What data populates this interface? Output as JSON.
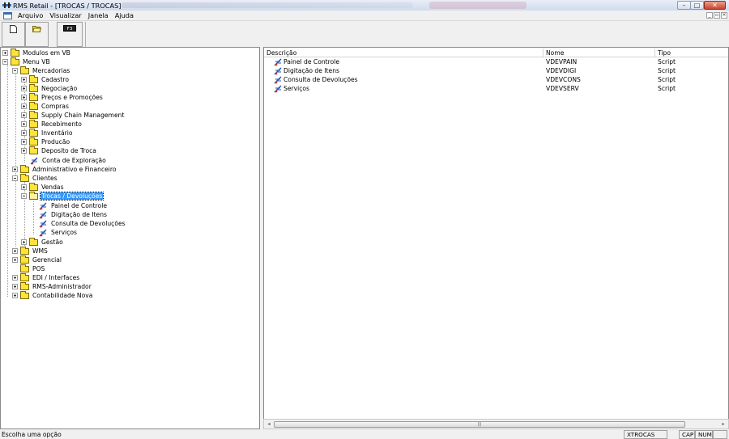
{
  "window": {
    "title": "RMS Retail - [TROCAS / TROCAS]",
    "min_glyph": "–",
    "max_glyph": "□",
    "close_glyph": "✕"
  },
  "menu": {
    "items": [
      {
        "label": "Arquivo"
      },
      {
        "label": "Visualizar"
      },
      {
        "label": "Janela"
      },
      {
        "label": "Ajuda"
      }
    ],
    "mdi_min": "_",
    "mdi_max": "▫",
    "mdi_close": "×"
  },
  "toolbar": {
    "f3_label": "F3"
  },
  "tree": {
    "modulos": "Modulos em VB",
    "menu_vb": "Menu VB",
    "mercadorias": "Mercadorias",
    "cadastro": "Cadastro",
    "negociacao": "Negociação",
    "precos": "Preços e Promoções",
    "compras": "Compras",
    "scm": "Supply Chain Management",
    "recebimento": "Recebimento",
    "inventario": "Inventário",
    "producao": "Producão",
    "deposito": "Deposito de Troca",
    "conta": "Conta de Exploração",
    "adm": "Administrativo e Financeiro",
    "clientes": "Clientes",
    "vendas": "Vendas",
    "trocas": "Trocas / Devoluções",
    "painel": "Painel de Controle",
    "digitacao": "Digitação de Itens",
    "consulta": "Consulta de Devoluções",
    "servicos": "Serviços",
    "gestao": "Gestão",
    "wms": "WMS",
    "gerencial": "Gerencial",
    "pos": "POS",
    "edi": "EDI / Interfaces",
    "rmsadm": "RMS-Administrador",
    "contab": "Contabilidade Nova"
  },
  "list": {
    "headers": {
      "descricao": "Descrição",
      "nome": "Nome",
      "tipo": "Tipo"
    },
    "rows": [
      {
        "descricao": "Painel de Controle",
        "nome": "VDEVPAIN",
        "tipo": "Script"
      },
      {
        "descricao": "Digitação de Itens",
        "nome": "VDEVDIGI",
        "tipo": "Script"
      },
      {
        "descricao": "Consulta de Devoluções",
        "nome": "VDEVCONS",
        "tipo": "Script"
      },
      {
        "descricao": "Serviços",
        "nome": "VDEVSERV",
        "tipo": "Script"
      }
    ],
    "scroll_left": "◂",
    "scroll_right": "▸",
    "scroll_grip": "|||"
  },
  "status": {
    "message": "Escolha uma opção",
    "form": "XTROCAS",
    "cap": "CAP",
    "num": "NUM"
  },
  "icons": {
    "app": "app-icon",
    "script": "script-icon",
    "folder": "folder-icon",
    "folder_open": "folder-open-icon"
  },
  "colors": {
    "selection": "#3399ff",
    "folder": "#ffe23a",
    "close_button": "#c9432b"
  }
}
